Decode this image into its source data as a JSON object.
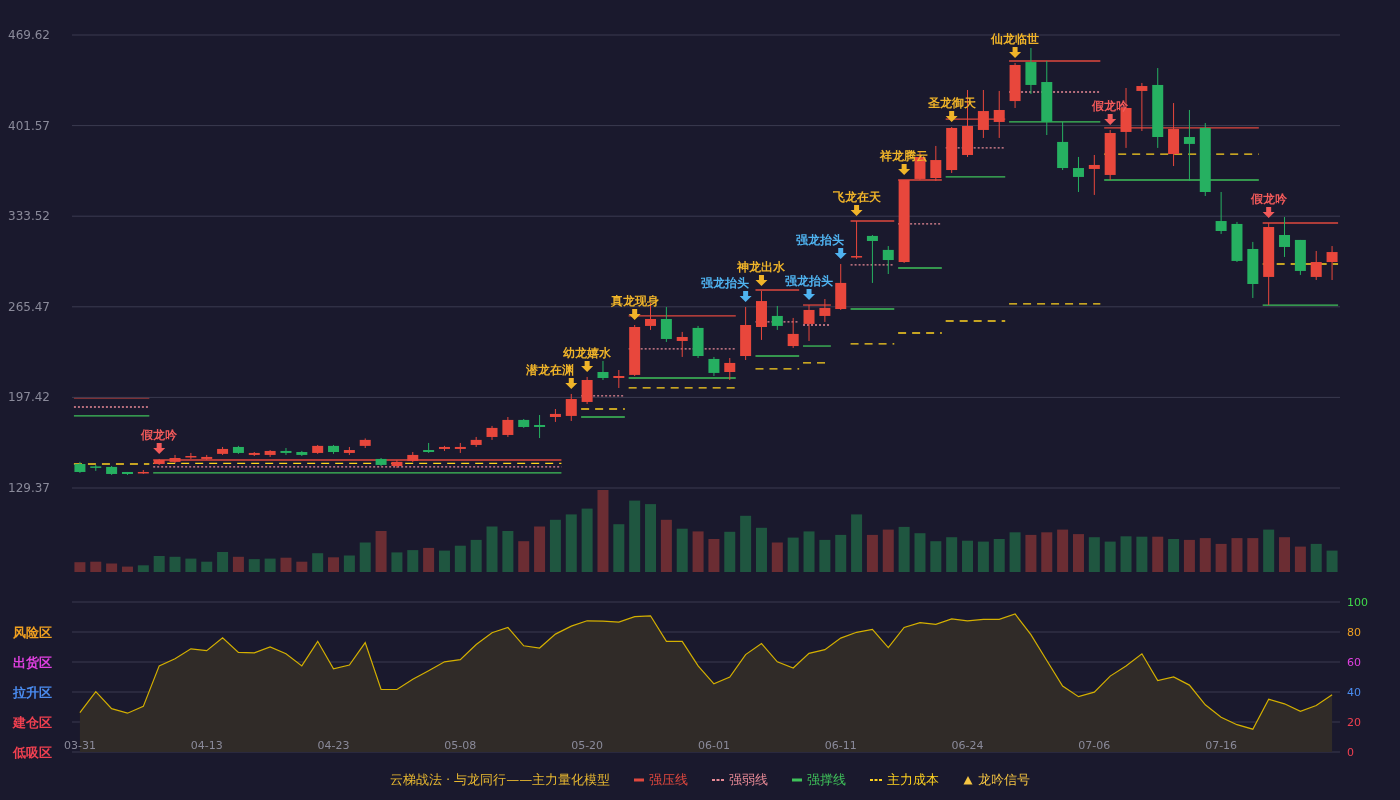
{
  "price_chart": {
    "chart_data": {
      "type": "candlestick",
      "grid": true,
      "ylim": [
        129.37,
        469.62
      ],
      "value_labels": [
        null,
        null,
        null,
        null,
        null,
        "假龙吟",
        null,
        null,
        null,
        null,
        null,
        null,
        null,
        null,
        null,
        null,
        null,
        null,
        null,
        null,
        null,
        null,
        null,
        null,
        null,
        null,
        null,
        null,
        null,
        null,
        null,
        "潜龙在渊",
        "幼龙嬉水",
        null,
        null,
        "真龙现身",
        null,
        null,
        null,
        null,
        null,
        null,
        "强龙抬头",
        "神龙出水",
        null,
        null,
        "强龙抬头",
        null,
        "强龙抬头",
        "飞龙在天",
        null,
        null,
        "祥龙腾云",
        null,
        null,
        "圣龙御天",
        null,
        null,
        null,
        "仙龙临世",
        null,
        null,
        null,
        null,
        null,
        "假龙吟",
        null,
        null,
        null,
        null,
        null,
        null,
        null,
        null,
        null,
        "假龙吟",
        null,
        null,
        null,
        null
      ],
      "yticks": [
        {
          "value": 469.62,
          "label": "469.62"
        },
        {
          "value": 401.57,
          "label": "401.57"
        },
        {
          "value": 333.52,
          "label": "333.52"
        },
        {
          "value": 265.47,
          "label": "265.47"
        },
        {
          "value": 197.42,
          "label": "197.42"
        },
        {
          "value": 129.37,
          "label": "129.37"
        }
      ],
      "ohlc": [
        [
          147.4,
          149.0,
          140.7,
          141.4
        ],
        [
          145.6,
          146.7,
          142.2,
          144.8
        ],
        [
          145.2,
          145.9,
          139.2,
          139.9
        ],
        [
          141.4,
          141.4,
          139.2,
          139.9
        ],
        [
          140.7,
          142.9,
          139.9,
          141.4
        ],
        [
          147.4,
          151.2,
          146.7,
          150.4
        ],
        [
          149.0,
          154.2,
          148.2,
          151.9
        ],
        [
          152.7,
          155.7,
          151.2,
          153.4
        ],
        [
          151.2,
          154.2,
          150.4,
          152.7
        ],
        [
          155.0,
          160.2,
          154.2,
          158.7
        ],
        [
          160.2,
          161.0,
          155.0,
          155.7
        ],
        [
          154.2,
          156.4,
          153.4,
          155.7
        ],
        [
          154.2,
          157.9,
          152.7,
          157.2
        ],
        [
          157.2,
          159.4,
          154.2,
          155.7
        ],
        [
          156.4,
          157.2,
          153.4,
          154.2
        ],
        [
          155.7,
          161.7,
          155.0,
          161.0
        ],
        [
          161.0,
          161.7,
          155.0,
          156.4
        ],
        [
          155.7,
          160.2,
          154.2,
          157.9
        ],
        [
          161.0,
          166.6,
          159.4,
          165.5
        ],
        [
          151.2,
          151.9,
          145.9,
          146.7
        ],
        [
          145.9,
          150.4,
          144.4,
          149.0
        ],
        [
          149.7,
          156.4,
          149.0,
          154.2
        ],
        [
          157.9,
          163.2,
          155.7,
          156.4
        ],
        [
          158.7,
          161.0,
          157.2,
          160.2
        ],
        [
          158.7,
          163.2,
          155.7,
          160.2
        ],
        [
          161.7,
          167.7,
          160.2,
          165.5
        ],
        [
          167.7,
          176.0,
          165.5,
          174.5
        ],
        [
          169.2,
          182.7,
          167.7,
          180.5
        ],
        [
          180.5,
          181.2,
          174.5,
          175.2
        ],
        [
          176.7,
          184.2,
          166.9,
          175.2
        ],
        [
          182.7,
          188.7,
          179.0,
          185.0
        ],
        [
          183.5,
          200.0,
          179.7,
          196.2
        ],
        [
          194.0,
          212.8,
          192.5,
          210.5
        ],
        [
          216.5,
          224.8,
          210.5,
          212.0
        ],
        [
          212.0,
          218.0,
          204.5,
          213.5
        ],
        [
          214.3,
          251.8,
          213.5,
          250.3
        ],
        [
          251.1,
          268.3,
          248.1,
          256.3
        ],
        [
          256.3,
          265.3,
          239.1,
          241.3
        ],
        [
          239.8,
          246.6,
          227.8,
          242.8
        ],
        [
          249.6,
          251.1,
          227.0,
          228.5
        ],
        [
          226.3,
          227.8,
          213.5,
          215.8
        ],
        [
          216.5,
          227.0,
          210.5,
          223.3
        ],
        [
          228.5,
          265.3,
          225.5,
          251.8
        ],
        [
          250.3,
          277.4,
          240.6,
          269.8
        ],
        [
          258.6,
          266.1,
          248.1,
          251.1
        ],
        [
          236.0,
          257.1,
          234.6,
          245.1
        ],
        [
          252.6,
          266.8,
          239.8,
          263.1
        ],
        [
          258.6,
          271.3,
          254.1,
          264.6
        ],
        [
          263.8,
          297.6,
          263.1,
          283.4
        ],
        [
          302.9,
          329.9,
          301.4,
          303.6
        ],
        [
          318.7,
          319.4,
          283.4,
          314.9
        ],
        [
          308.2,
          311.1,
          290.1,
          300.6
        ],
        [
          299.1,
          360.7,
          298.4,
          360.7
        ],
        [
          361.5,
          381.7,
          360.7,
          378.0
        ],
        [
          362.2,
          386.3,
          360.0,
          375.7
        ],
        [
          368.2,
          400.5,
          366.0,
          399.8
        ],
        [
          379.5,
          428.3,
          378.0,
          401.3
        ],
        [
          398.3,
          428.3,
          392.3,
          412.5
        ],
        [
          404.3,
          427.6,
          392.3,
          413.3
        ],
        [
          420.0,
          448.6,
          414.8,
          447.1
        ],
        [
          449.3,
          459.9,
          425.3,
          432.1
        ],
        [
          434.3,
          450.1,
          394.5,
          404.3
        ],
        [
          389.3,
          404.3,
          368.2,
          369.7
        ],
        [
          369.7,
          378.0,
          351.7,
          363.0
        ],
        [
          369.0,
          379.5,
          349.5,
          372.0
        ],
        [
          364.5,
          398.3,
          360.7,
          396.0
        ],
        [
          396.8,
          429.8,
          384.8,
          414.8
        ],
        [
          427.6,
          433.6,
          397.5,
          431.3
        ],
        [
          432.1,
          444.8,
          384.8,
          393.0
        ],
        [
          380.2,
          418.5,
          371.2,
          399.0
        ],
        [
          393.0,
          413.3,
          360.0,
          387.8
        ],
        [
          399.8,
          403.5,
          348.7,
          351.7
        ],
        [
          329.9,
          351.7,
          320.2,
          322.4
        ],
        [
          327.7,
          329.2,
          299.1,
          299.9
        ],
        [
          308.9,
          314.2,
          272.1,
          282.6
        ],
        [
          287.9,
          328.4,
          266.8,
          325.4
        ],
        [
          319.4,
          332.9,
          302.9,
          310.4
        ],
        [
          315.7,
          315.7,
          289.4,
          292.4
        ],
        [
          287.9,
          307.4,
          285.6,
          299.1
        ],
        [
          299.1,
          311.1,
          285.6,
          306.6
        ]
      ]
    }
  },
  "signals": [
    {
      "color": "#f25a5a"
    },
    {
      "color": "#f0b429"
    },
    {
      "color": "#f0b429"
    },
    {
      "color": "#f0b429"
    },
    {
      "color": "#4fb3f0"
    },
    {
      "color": "#f0b429"
    },
    {
      "color": "#4fb3f0"
    },
    {
      "color": "#4fb3f0"
    },
    {
      "color": "#f0b429"
    },
    {
      "color": "#f0b429"
    },
    {
      "color": "#f0b429"
    },
    {
      "color": "#f0b429"
    },
    {
      "color": "#f25a5a"
    },
    {
      "color": "#f25a5a"
    }
  ],
  "indicator": {
    "zones": [
      {
        "label": "风险区",
        "color": "#f0a020"
      },
      {
        "label": "出货区",
        "color": "#e040e0"
      },
      {
        "label": "拉升区",
        "color": "#4a8cf0"
      },
      {
        "label": "建仓区",
        "color": "#f04050"
      },
      {
        "label": "低吸区",
        "color": "#f04050"
      }
    ],
    "chart_data": {
      "type": "area",
      "grid": true,
      "ylim": [
        0,
        100
      ],
      "categories": [
        "03-31",
        null,
        null,
        null,
        null,
        null,
        null,
        null,
        "04-13",
        null,
        null,
        null,
        null,
        null,
        null,
        null,
        "04-23",
        null,
        null,
        null,
        null,
        null,
        null,
        null,
        "05-08",
        null,
        null,
        null,
        null,
        null,
        null,
        null,
        "05-20",
        null,
        null,
        null,
        null,
        null,
        null,
        null,
        "06-01",
        null,
        null,
        null,
        null,
        null,
        null,
        null,
        "06-11",
        null,
        null,
        null,
        null,
        null,
        null,
        null,
        "06-24",
        null,
        null,
        null,
        null,
        null,
        null,
        null,
        "07-06",
        null,
        null,
        null,
        null,
        null,
        null,
        null,
        "07-16",
        null,
        null,
        null,
        null,
        null,
        null,
        null
      ],
      "yticks": [
        {
          "value": 100,
          "label": "100"
        },
        {
          "value": 80,
          "label": "80"
        },
        {
          "value": 60,
          "label": "60"
        },
        {
          "value": 40,
          "label": "40"
        },
        {
          "value": 20,
          "label": "20"
        },
        {
          "value": 0,
          "label": "0"
        }
      ],
      "values": [
        26.2,
        40.2,
        28.9,
        25.9,
        30.4,
        57.4,
        62.2,
        68.8,
        67.6,
        76.2,
        66.4,
        66.1,
        70.0,
        65.5,
        57.4,
        73.8,
        55.4,
        58.0,
        72.9,
        41.7,
        41.7,
        48.5,
        54.2,
        60.1,
        61.6,
        71.7,
        79.5,
        83.0,
        70.8,
        69.3,
        78.6,
        83.9,
        87.5,
        87.2,
        86.6,
        90.2,
        90.8,
        73.8,
        73.8,
        57.4,
        45.5,
        50.0,
        64.9,
        72.3,
        60.1,
        56.0,
        65.8,
        68.2,
        75.9,
        79.8,
        81.8,
        69.6,
        83.0,
        86.3,
        85.1,
        88.7,
        87.5,
        88.4,
        88.4,
        92.0,
        78.3,
        61.0,
        44.0,
        36.9,
        39.9,
        50.6,
        57.4,
        65.5,
        47.6,
        50.0,
        44.6,
        31.5,
        23.2,
        18.2,
        15.2,
        35.1,
        32.1,
        27.1,
        31.0,
        38.1
      ]
    }
  },
  "legend": {
    "title": "云梯战法 · 与龙同行——主力量化模型",
    "items": [
      {
        "label": "强压线",
        "color": "#e0483e"
      },
      {
        "label": "强弱线",
        "color": "#e88a96"
      },
      {
        "label": "强撑线",
        "color": "#3fc25a"
      },
      {
        "label": "主力成本",
        "color": "#ffd21f"
      }
    ],
    "signal_label": "龙吟信号"
  }
}
